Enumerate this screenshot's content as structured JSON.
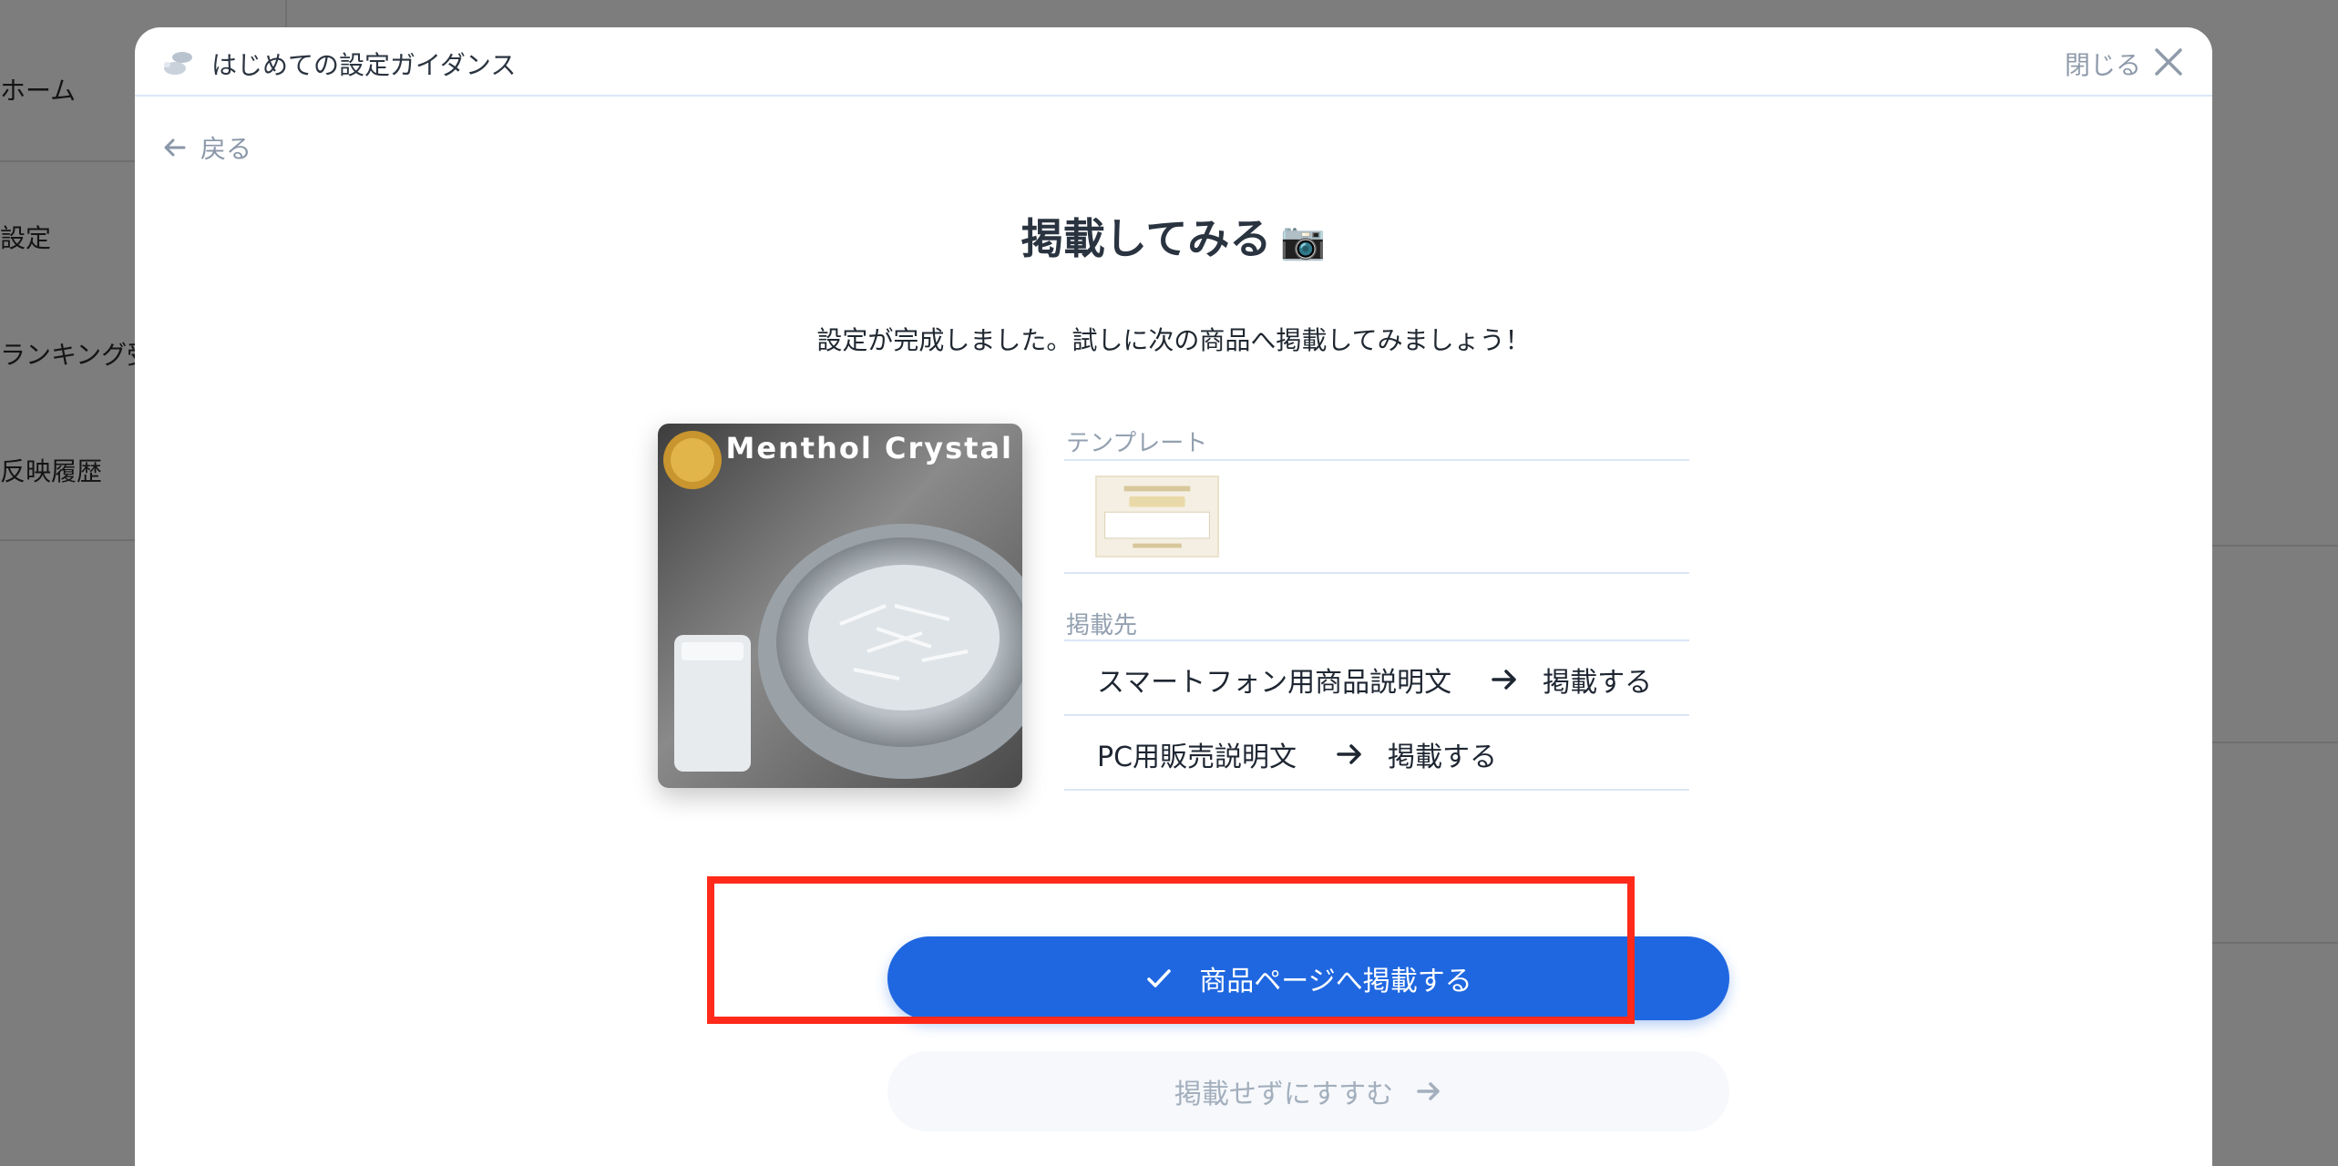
{
  "background": {
    "sidebar_items": [
      "ホーム",
      "設定",
      "ランキング受",
      "反映履歴"
    ]
  },
  "modal": {
    "title": "はじめての設定ガイダンス",
    "close_label": "閉じる",
    "back_label": "戻る",
    "heading": "掲載してみる",
    "heading_emoji": "📷",
    "subtitle": "設定が完成しました。試しに次の商品へ掲載してみましょう！",
    "product_image_text": "Menthol Crystal",
    "template_label": "テンプレート",
    "destination_label": "掲載先",
    "destinations": [
      {
        "name": "スマートフォン用商品説明文",
        "action": "掲載する"
      },
      {
        "name": "PC用販売説明文",
        "action": "掲載する"
      }
    ],
    "primary_button": "商品ページへ掲載する",
    "secondary_button": "掲載せずにすすむ"
  },
  "colors": {
    "primary": "#1f67e0",
    "highlight": "#ff2a1a",
    "overlay": "#7d7d7d"
  }
}
